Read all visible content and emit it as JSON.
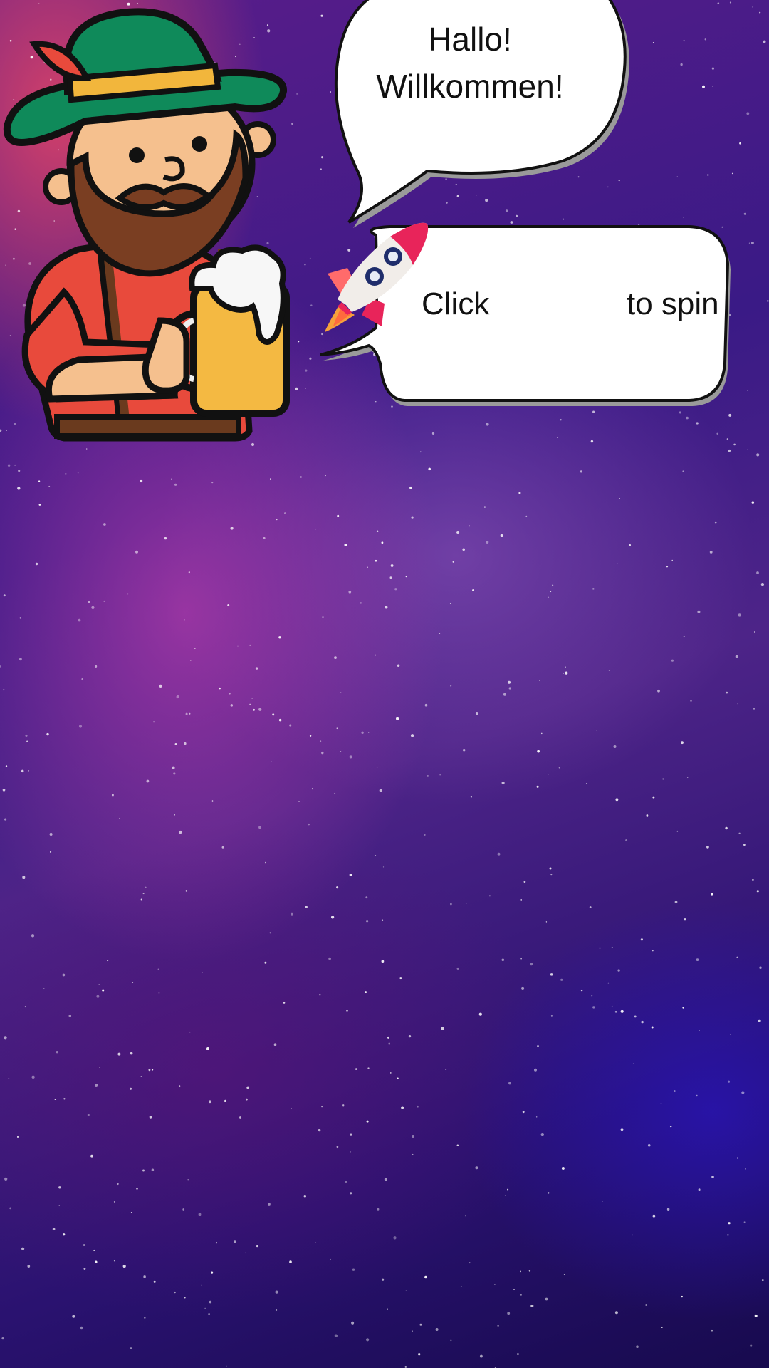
{
  "colors": {
    "background_top": "#5a1d8a",
    "background_bottom": "#170a4e",
    "bubble_fill": "#ffffff",
    "bubble_shadow": "#9a9a9a",
    "text": "#111111",
    "hat": "#0f8a5a",
    "hat_band": "#f2b63c",
    "beard": "#7a3e22",
    "shirt": "#e84a3c",
    "beer": "#f4b942",
    "rocket_accent": "#e8245a"
  },
  "character": {
    "icon": "bavarian-man-with-beer-icon"
  },
  "greeting_bubble": {
    "line1": "Hallo!",
    "line2": "Willkommen!"
  },
  "spin_bubble": {
    "prefix": "Click",
    "suffix": "to spin",
    "button_icon": "rocket-icon"
  }
}
